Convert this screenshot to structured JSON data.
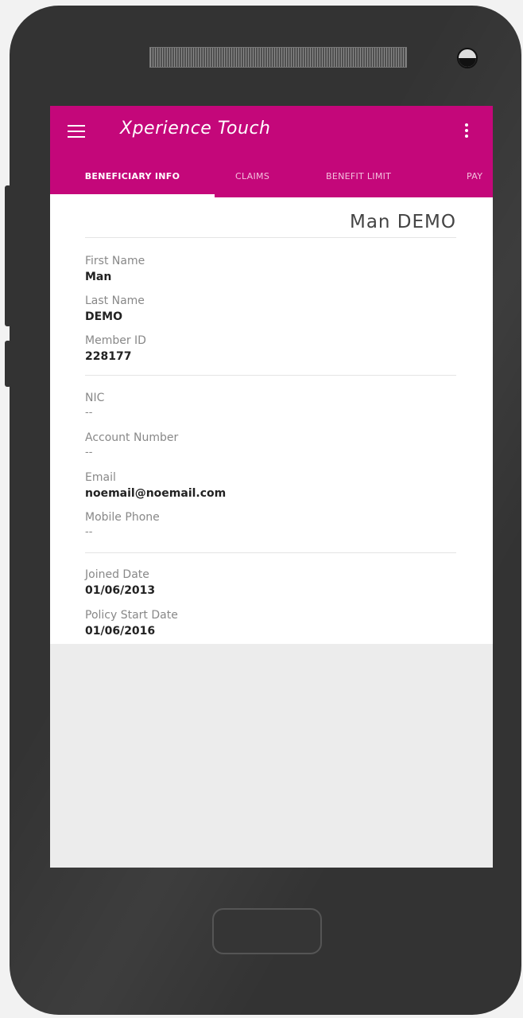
{
  "app": {
    "title": "Xperience Touch"
  },
  "tabs": [
    {
      "label": "BENEFICIARY INFO",
      "active": true
    },
    {
      "label": "CLAIMS"
    },
    {
      "label": "BENEFIT LIMIT"
    },
    {
      "label": "PAY"
    }
  ],
  "beneficiary": {
    "display_name": "Man DEMO",
    "first_name_label": "First Name",
    "first_name": "Man",
    "last_name_label": "Last Name",
    "last_name": "DEMO",
    "member_id_label": "Member ID",
    "member_id": "228177",
    "nic_label": "NIC",
    "nic": "--",
    "account_label": "Account Number",
    "account": "--",
    "email_label": "Email",
    "email": "noemail@noemail.com",
    "mobile_label": "Mobile Phone",
    "mobile": "--",
    "joined_label": "Joined Date",
    "joined": "01/06/2013",
    "policy_start_label": "Policy Start Date",
    "policy_start": "01/06/2016"
  },
  "colors": {
    "accent": "#c4077a",
    "phone_body": "#333333",
    "screen_bg": "#ececec"
  },
  "icons": {
    "menu": "hamburger-menu-icon",
    "overflow": "more-vertical-icon"
  }
}
